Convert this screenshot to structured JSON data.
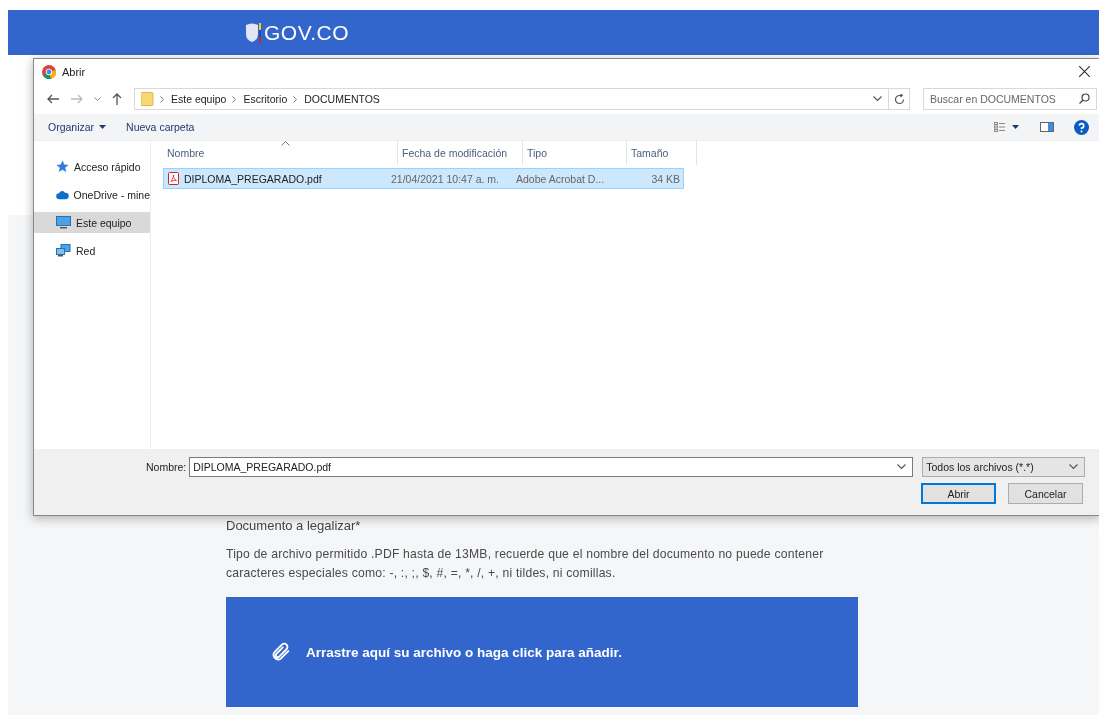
{
  "header": {
    "logo_text": "GOV.CO"
  },
  "dialog": {
    "title": "Abrir",
    "breadcrumb": [
      "Este equipo",
      "Escritorio",
      "DOCUMENTOS"
    ],
    "search": {
      "placeholder": "Buscar en DOCUMENTOS"
    },
    "toolbar": [
      {
        "label": "Organizar",
        "kind": "menu"
      },
      {
        "label": "Nueva carpeta",
        "kind": "button"
      }
    ],
    "nav": [
      {
        "label": "Acceso rápido",
        "kind": "star",
        "selected": false
      },
      {
        "label": "OneDrive - mine",
        "kind": "cloud",
        "selected": false
      },
      {
        "label": "Este equipo",
        "kind": "computer",
        "selected": true
      },
      {
        "label": "Red",
        "kind": "network",
        "selected": false
      }
    ],
    "columns": [
      "Nombre",
      "Fecha de modificación",
      "Tipo",
      "Tamaño"
    ],
    "files": [
      {
        "name": "DIPLOMA_PREGARADO.pdf",
        "modified": "21/04/2021 10:47 a. m.",
        "type": "Adobe Acrobat D...",
        "size": "34 KB",
        "selected": true
      }
    ],
    "filename_label": "Nombre:",
    "filename_value": "DIPLOMA_PREGARADO.pdf",
    "filetype": "Todos los archivos (*.*)",
    "buttons": [
      {
        "label": "Abrir",
        "kind": "primary"
      },
      {
        "label": "Cancelar",
        "kind": "secondary"
      }
    ]
  },
  "form": {
    "label": "Documento a legalizar*",
    "hint": "Tipo de archivo permitido .PDF hasta de 13MB, recuerde que el nombre del documento no puede contener caracteres especiales como: -, :, ;, $, #, =, *, /, +, ni tildes, ni comillas.",
    "dropzone": "Arrastre aquí su archivo o haga click para añadir."
  }
}
